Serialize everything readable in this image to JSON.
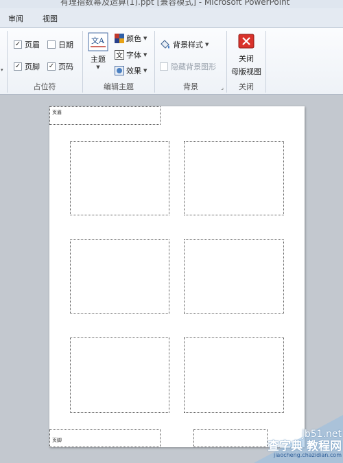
{
  "window": {
    "title": "有理指数幂及运算(1).ppt [兼容模式] - Microsoft PowerPoint"
  },
  "tabs": [
    {
      "label": "审阅"
    },
    {
      "label": "视图"
    }
  ],
  "ribbon": {
    "placeholders_group": {
      "label": "占位符",
      "header": {
        "label": "页眉",
        "checked": true
      },
      "date": {
        "label": "日期",
        "checked": false
      },
      "footer": {
        "label": "页脚",
        "checked": true
      },
      "page_number": {
        "label": "页码",
        "checked": true
      },
      "check_mark": "✓"
    },
    "theme_group": {
      "label": "编辑主题",
      "theme_button": "主题",
      "colors_button": "颜色",
      "fonts_button": "字体",
      "effects_button": "效果"
    },
    "background_group": {
      "label": "背景",
      "styles_button": "背景样式",
      "hide_graphics": {
        "label": "隐藏背景图形",
        "checked": false,
        "enabled": false
      }
    },
    "close_group": {
      "label": "关闭",
      "close_button_line1": "关闭",
      "close_button_line2": "母版视图"
    }
  },
  "handout": {
    "header_label": "页眉",
    "footer_label": "页脚",
    "slides_per_page": 6
  },
  "watermark": {
    "line1": "jb51.net",
    "line2": "查字典 教程网",
    "line3": "jiaocheng.chazidian.com"
  }
}
